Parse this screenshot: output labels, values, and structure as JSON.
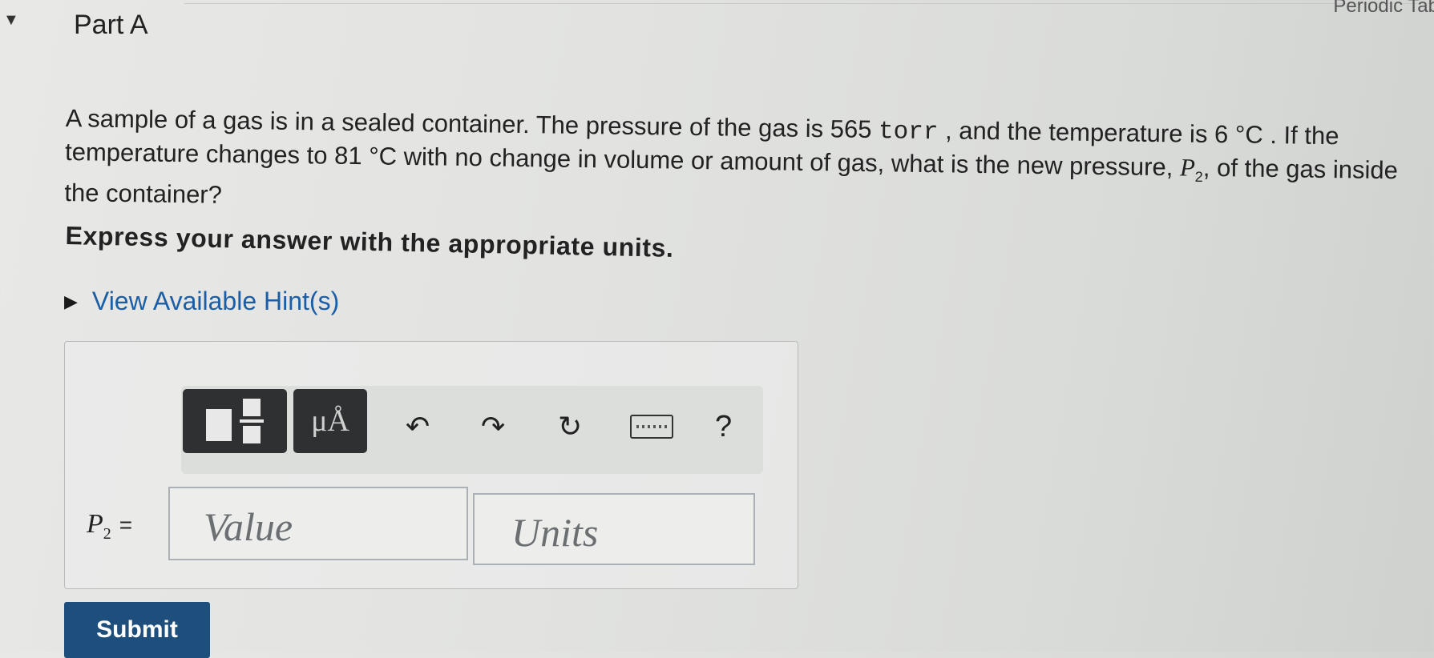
{
  "header": {
    "part_title": "Part A",
    "periodic_table_link": "Periodic Tab"
  },
  "question": {
    "line1_pre": "A sample of a gas is in a sealed container. The pressure of the gas is 565 ",
    "unit_torr": "torr",
    "line1_mid": " , and the temperature is 6 ",
    "deg_c1": "°C",
    "line1_post": " . If the",
    "line2_pre": "temperature changes to 81 ",
    "deg_c2": "°C",
    "line2_post": " with no change in volume or amount of gas, what is the new pressure, ",
    "var_p": "P",
    "var_sub": "2",
    "line2_end": ", of the gas inside",
    "line3": "the container?"
  },
  "instruction": "Express your answer with the appropriate units.",
  "hints": {
    "label": "View Available Hint(s)"
  },
  "toolbar": {
    "units_label": "μÅ",
    "undo_icon": "undo-icon",
    "redo_icon": "redo-icon",
    "reset_icon": "reset-icon",
    "keyboard_icon": "keyboard-icon",
    "help_label": "?"
  },
  "answer": {
    "variable": "P",
    "variable_sub": "2",
    "equals": "=",
    "value_placeholder": "Value",
    "units_placeholder": "Units"
  },
  "submit_label": "Submit"
}
